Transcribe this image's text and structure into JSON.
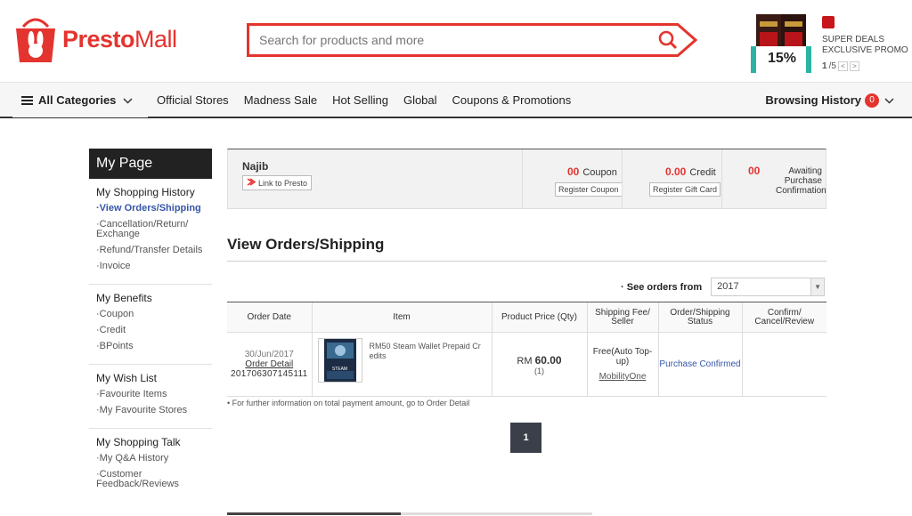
{
  "header": {
    "brand_a": "Presto",
    "brand_b": "Mall",
    "search_placeholder": "Search for products and more",
    "promo": {
      "line1": "SUPER DEALS",
      "line2": "EXCLUSIVE PROMO",
      "discount": "15%",
      "pager_current": "1",
      "pager_total": "/5",
      "prev": "<",
      "next": ">"
    }
  },
  "nav": {
    "all_categories": "All Categories",
    "links": [
      "Official Stores",
      "Madness Sale",
      "Hot Selling",
      "Global",
      "Coupons & Promotions"
    ],
    "history_label": "Browsing History",
    "history_count": "0"
  },
  "sidebar": {
    "title": "My Page",
    "sections": [
      {
        "title": "My Shopping History",
        "items": [
          "View Orders/Shipping",
          "Cancellation/Return/ Exchange",
          "Refund/Transfer Details",
          "Invoice"
        ]
      },
      {
        "title": "My Benefits",
        "items": [
          "Coupon",
          "Credit",
          "BPoints"
        ]
      },
      {
        "title": "My Wish List",
        "items": [
          "Favourite Items",
          "My Favourite Stores"
        ]
      },
      {
        "title": "My Shopping Talk",
        "items": [
          "My Q&A History",
          "Customer Feedback/Reviews"
        ]
      }
    ]
  },
  "summary": {
    "user_name": "Najib",
    "link_label": "Link to Presto",
    "coupon_count": "00",
    "coupon_label": "Coupon",
    "coupon_btn": "Register Coupon",
    "credit_value": "0.00",
    "credit_label": "Credit",
    "credit_btn": "Register Gift Card",
    "awaiting_count": "00",
    "awaiting_label": "Awaiting Purchase Confirmation"
  },
  "page_title": "View Orders/Shipping",
  "filter": {
    "label": "See orders from",
    "value": "2017"
  },
  "table": {
    "headers": [
      "Order Date",
      "Item",
      "Product Price (Qty)",
      "Shipping Fee/ Seller",
      "Order/Shipping Status",
      "Confirm/ Cancel/Review"
    ],
    "rows": [
      {
        "date": "30/Jun/2017",
        "detail_link": "Order Detail",
        "order_no": "201706307145111",
        "item": "RM50 Steam Wallet Prepaid Cr edits",
        "thumb_label": "STEAM",
        "currency": "RM",
        "price": "60.00",
        "qty": "(1)",
        "shipping": "Free(Auto Top-up)",
        "seller": "MobilityOne",
        "status": "Purchase Confirmed"
      }
    ]
  },
  "note": "• For further information on total payment amount, go to Order Detail",
  "pagination": {
    "current": "1"
  },
  "colors": {
    "brand": "#e4342f",
    "link_blue": "#3556a8",
    "dark": "#222222"
  }
}
